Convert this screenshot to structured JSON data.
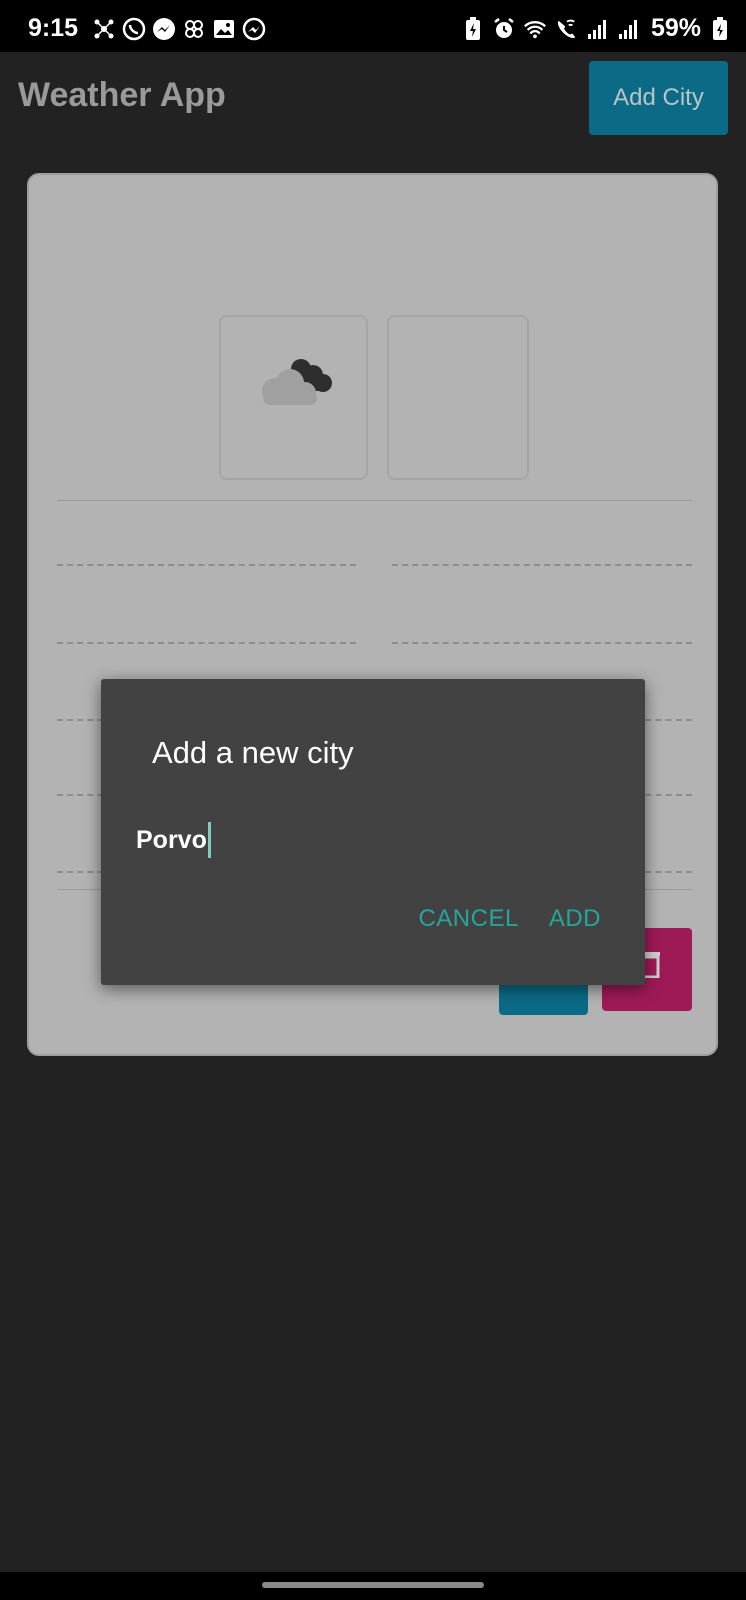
{
  "status_bar": {
    "time": "9:15",
    "battery_percent": "59%",
    "left_icons": [
      "network-icon",
      "whatsapp-icon",
      "messenger-icon",
      "pinwheel-icon",
      "gallery-icon",
      "messenger-icon"
    ],
    "right_icons": [
      "battery-saver-icon",
      "alarm-icon",
      "wifi-icon",
      "wifi-call-icon",
      "signal-icon",
      "signal-icon",
      "battery-icon"
    ]
  },
  "app_bar": {
    "title": "Weather App",
    "add_city_label": "Add City"
  },
  "card": {
    "weather_icon": "cloud-icon"
  },
  "dialog": {
    "title": "Add a new city",
    "input_value": "Porvo",
    "cancel_label": "CANCEL",
    "add_label": "ADD"
  },
  "colors": {
    "background": "#222222",
    "card": "#b3b3b3",
    "accent_blue": "#0b6b86",
    "accent_red": "#9e1a57",
    "dialog": "#424242",
    "dialog_action": "#26a69a"
  }
}
